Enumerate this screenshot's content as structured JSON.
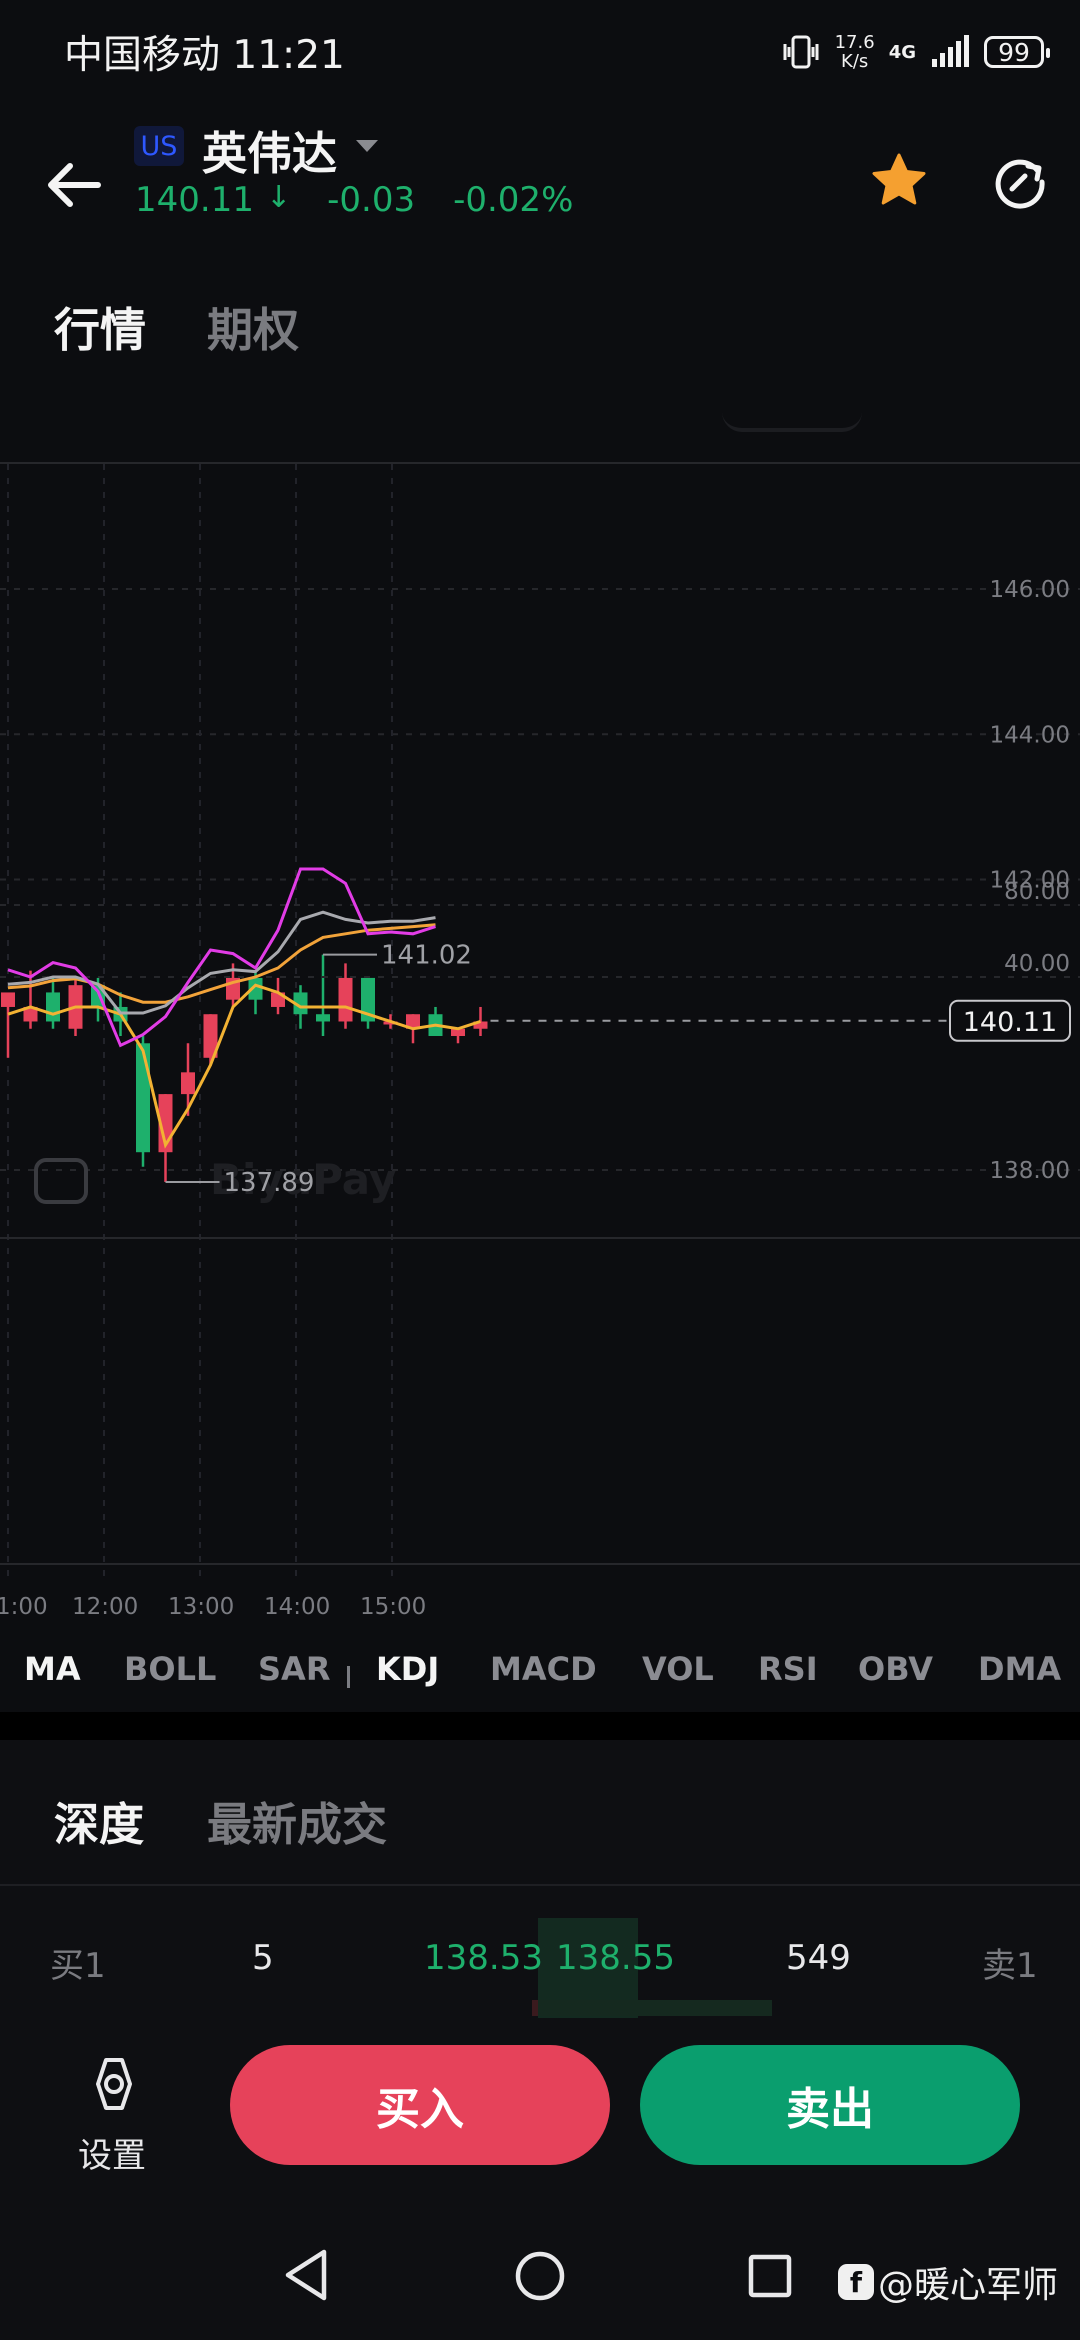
{
  "status_bar": {
    "carrier": "中国移动",
    "time": "11:21",
    "net_speed_value": "17.6",
    "net_speed_unit": "K/s",
    "network": "4G",
    "battery": "99"
  },
  "header": {
    "market": "US",
    "name": "英伟达",
    "price": "140.11",
    "arrow": "↓",
    "change": "-0.03",
    "change_pct": "-0.02%",
    "favorite_icon": "star-icon",
    "refresh_icon": "refresh-icon",
    "up_color": "#e6425a",
    "down_color": "#1eb06c"
  },
  "tabs": [
    {
      "label": "行情",
      "active": true
    },
    {
      "label": "期权",
      "active": false
    }
  ],
  "chart_data": {
    "type": "candlestick",
    "x_ticks": [
      "1:00",
      "12:00",
      "13:00",
      "14:00",
      "15:00"
    ],
    "y_ticks": [
      "146.00",
      "144.00",
      "142.00",
      "138.00"
    ],
    "ylim": [
      137.0,
      147.0
    ],
    "current_price": "140.11",
    "high_label": "141.02",
    "low_label": "137.89",
    "grid": true,
    "watermark": "BiyaPay",
    "candles": [
      {
        "o": 140.3,
        "h": 140.5,
        "l": 139.6,
        "c": 140.5
      },
      {
        "o": 140.1,
        "h": 140.8,
        "l": 140.0,
        "c": 140.3
      },
      {
        "o": 140.5,
        "h": 140.7,
        "l": 140.0,
        "c": 140.1
      },
      {
        "o": 140.0,
        "h": 140.7,
        "l": 139.9,
        "c": 140.6
      },
      {
        "o": 140.6,
        "h": 140.7,
        "l": 140.1,
        "c": 140.3
      },
      {
        "o": 140.3,
        "h": 140.5,
        "l": 139.9,
        "c": 140.1
      },
      {
        "o": 139.8,
        "h": 139.9,
        "l": 138.1,
        "c": 138.3
      },
      {
        "o": 138.3,
        "h": 139.1,
        "l": 137.89,
        "c": 139.1
      },
      {
        "o": 139.1,
        "h": 139.8,
        "l": 138.8,
        "c": 139.4
      },
      {
        "o": 139.6,
        "h": 140.2,
        "l": 139.5,
        "c": 140.2
      },
      {
        "o": 140.4,
        "h": 140.9,
        "l": 140.3,
        "c": 140.7
      },
      {
        "o": 140.7,
        "h": 140.8,
        "l": 140.2,
        "c": 140.4
      },
      {
        "o": 140.3,
        "h": 140.7,
        "l": 140.2,
        "c": 140.5
      },
      {
        "o": 140.5,
        "h": 140.6,
        "l": 140.0,
        "c": 140.2
      },
      {
        "o": 140.2,
        "h": 141.02,
        "l": 139.9,
        "c": 140.1
      },
      {
        "o": 140.1,
        "h": 140.9,
        "l": 140.0,
        "c": 140.7
      },
      {
        "o": 140.7,
        "h": 140.7,
        "l": 140.0,
        "c": 140.1
      },
      {
        "o": 140.1,
        "h": 140.2,
        "l": 140.0,
        "c": 140.1
      },
      {
        "o": 140.0,
        "h": 140.2,
        "l": 139.8,
        "c": 140.2
      },
      {
        "o": 140.2,
        "h": 140.3,
        "l": 139.9,
        "c": 139.9
      },
      {
        "o": 139.9,
        "h": 140.0,
        "l": 139.8,
        "c": 140.0
      },
      {
        "o": 140.0,
        "h": 140.3,
        "l": 139.9,
        "c": 140.1
      }
    ],
    "ma_line": [
      140.2,
      140.3,
      140.2,
      140.3,
      140.3,
      140.2,
      139.7,
      138.4,
      138.9,
      139.5,
      140.3,
      140.6,
      140.5,
      140.3,
      140.3,
      140.3,
      140.2,
      140.1,
      140.0,
      140.05,
      140.0,
      140.1
    ],
    "kdj": {
      "yticks": [
        "80.00",
        "40.00"
      ],
      "ylim": [
        0,
        110
      ],
      "j": [
        44,
        40,
        48,
        45,
        32,
        2,
        8,
        18,
        37,
        55,
        53,
        45,
        66,
        100,
        100,
        92,
        64,
        65,
        64,
        68
      ],
      "k": [
        36,
        37,
        40,
        40,
        36,
        20,
        20,
        24,
        34,
        42,
        44,
        43,
        54,
        72,
        76,
        72,
        70,
        71,
        71,
        73
      ],
      "d": [
        34,
        35,
        38,
        39,
        36,
        30,
        26,
        26,
        29,
        33,
        37,
        40,
        45,
        55,
        62,
        64,
        66,
        67,
        68,
        69
      ]
    }
  },
  "indicators": [
    {
      "label": "MA",
      "active": true
    },
    {
      "label": "BOLL",
      "active": false
    },
    {
      "label": "SAR",
      "active": false
    },
    {
      "label": "KDJ",
      "active": true
    },
    {
      "label": "MACD",
      "active": false
    },
    {
      "label": "VOL",
      "active": false
    },
    {
      "label": "RSI",
      "active": false
    },
    {
      "label": "OBV",
      "active": false
    },
    {
      "label": "DMA",
      "active": false
    }
  ],
  "depth_tabs": [
    {
      "label": "深度",
      "active": true
    },
    {
      "label": "最新成交",
      "active": false
    }
  ],
  "depth": {
    "bid_label": "买1",
    "bid_qty": "5",
    "bid_price": "138.53",
    "ask_price": "138.55",
    "ask_qty": "549",
    "ask_label": "卖1"
  },
  "actions": {
    "settings": "设置",
    "buy": "买入",
    "sell": "卖出"
  },
  "watermark": "@暖心军师"
}
